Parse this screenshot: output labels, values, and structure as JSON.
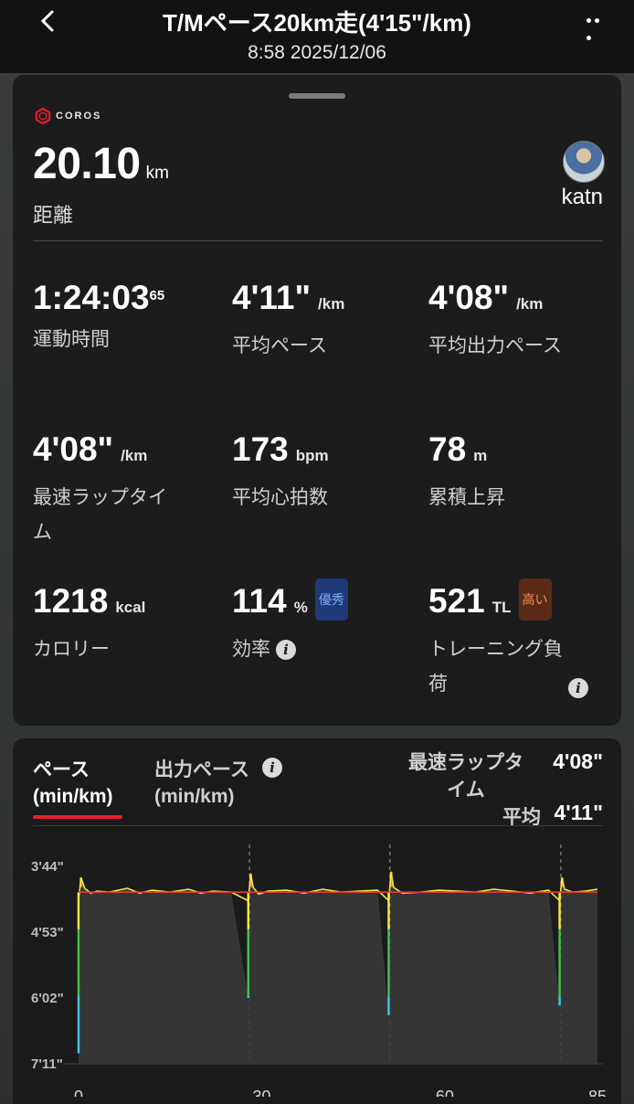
{
  "header": {
    "title": "T/Mペース20km走(4'15\"/km)",
    "subtitle": "8:58 2025/12/06",
    "back_icon": "chevron-left-icon",
    "more_icon": "more-horizontal-icon"
  },
  "summary": {
    "brand": "COROS",
    "distance": {
      "value": "20.10",
      "unit": "km",
      "label": "距離"
    },
    "user": "katn",
    "stats": [
      {
        "value": "1:24:03",
        "sup": "65",
        "unit": "",
        "label": "運動時間"
      },
      {
        "value": "4'11\"",
        "unit": "/km",
        "label": "平均ペース"
      },
      {
        "value": "4'08\"",
        "unit": "/km",
        "label": "平均出力ペース"
      },
      {
        "value": "4'08\"",
        "unit": "/km",
        "label": "最速ラップタイム"
      },
      {
        "value": "173",
        "unit": "bpm",
        "label": "平均心拍数"
      },
      {
        "value": "78",
        "unit": "m",
        "label": "累積上昇"
      },
      {
        "value": "1218",
        "unit": "kcal",
        "label": "カロリー"
      },
      {
        "value": "114",
        "unit": "%",
        "badge": "優秀",
        "label": "効率"
      },
      {
        "value": "521",
        "unit": "TL",
        "badge": "高い",
        "label": "トレーニング負荷"
      }
    ]
  },
  "chart_panel": {
    "tabs": [
      {
        "label": "ペース",
        "unit": "(min/km)",
        "active": true
      },
      {
        "label": "出力ペース",
        "unit": "(min/km)",
        "active": false
      }
    ],
    "fastest_lap_label": "最速ラップタイム",
    "fastest_lap_value": "4'08\"",
    "avg_label": "平均",
    "avg_value": "4'11\""
  },
  "chart_data": {
    "type": "line",
    "title": "",
    "xlabel": "",
    "ylabel": "",
    "x_ticks": [
      "0",
      "30",
      "60",
      "85"
    ],
    "y_ticks": [
      "3'44\"",
      "4'53\"",
      "6'02\"",
      "7'11\""
    ],
    "y_tick_seconds": [
      224,
      293,
      362,
      431
    ],
    "x_range": [
      0,
      85
    ],
    "avg_pace_seconds": 251,
    "lap_markers_x": [
      28,
      51,
      79
    ],
    "series": [
      {
        "x": [
          0,
          0.4,
          1,
          2,
          3,
          5,
          8,
          10,
          12,
          15,
          18,
          20,
          22,
          25,
          27.8,
          28.2,
          28.6,
          29.5,
          31,
          34,
          37,
          40,
          43,
          46,
          49,
          50.8,
          51.2,
          51.6,
          53,
          56,
          59,
          62,
          65,
          68,
          71,
          74,
          77,
          78.8,
          79.2,
          79.6,
          81,
          83,
          85
        ],
        "y": [
          420,
          236,
          247,
          252,
          250,
          251,
          247,
          252,
          249,
          251,
          248,
          252,
          250,
          251,
          362,
          232,
          246,
          253,
          250,
          249,
          252,
          248,
          251,
          250,
          249,
          380,
          230,
          246,
          252,
          251,
          249,
          250,
          251,
          248,
          250,
          252,
          249,
          370,
          236,
          248,
          251,
          250,
          248
        ]
      }
    ]
  },
  "colors": {
    "accent_red": "#e4202a",
    "pace_line": "#f5e64a",
    "avg_line": "#e33b2e",
    "fast_orange": "#ef7b2e",
    "slow_green": "#3ec14a",
    "slow_cyan": "#3bc4e0"
  }
}
